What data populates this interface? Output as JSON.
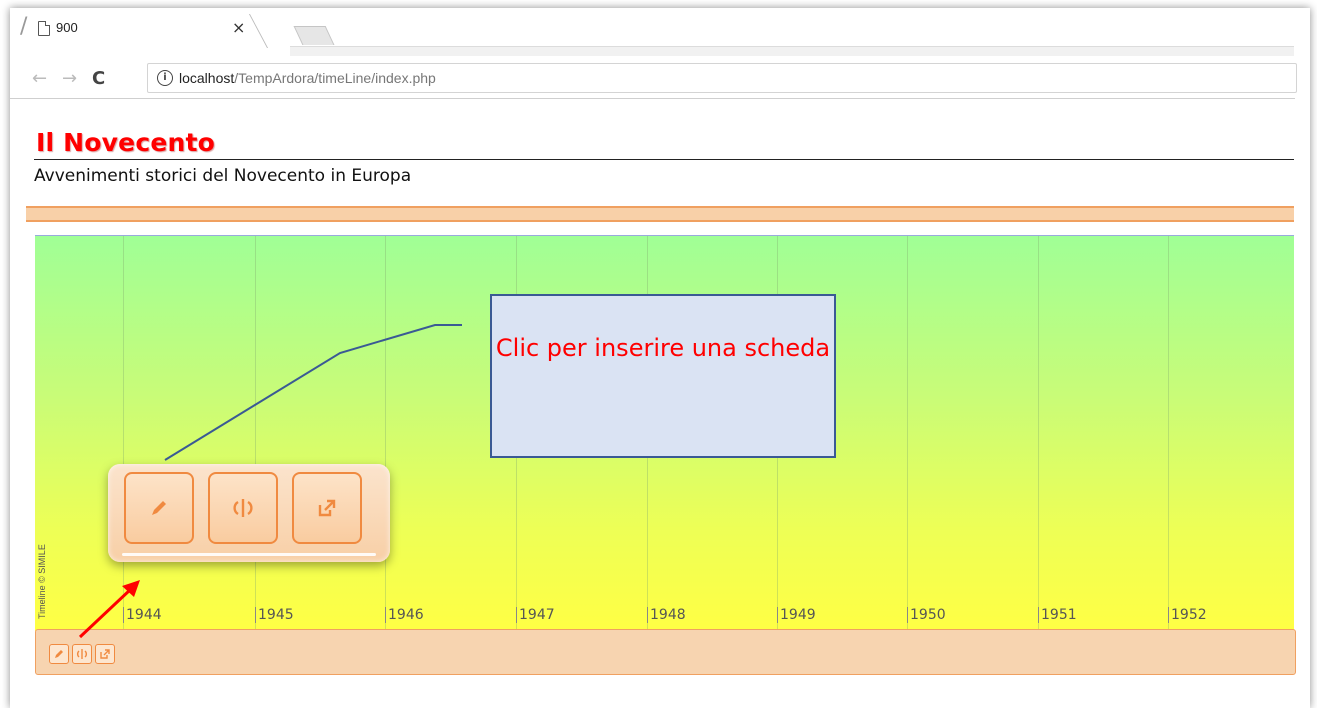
{
  "browser": {
    "tab_title": "900",
    "tab_close": "×",
    "url_host": "localhost",
    "url_path": "/TempArdora/timeLine/index.php",
    "info_icon": "i"
  },
  "page": {
    "title": "Il Novecento",
    "subtitle": "Avvenimenti storici del Novecento in Europa"
  },
  "timeline": {
    "credit": "Timeline © SIMILE",
    "years": [
      "1944",
      "1945",
      "1946",
      "1947",
      "1948",
      "1949",
      "1950",
      "1951",
      "1952"
    ],
    "gradient_colors": [
      "#a0ff96",
      "#ffff44"
    ]
  },
  "popup": {
    "buttons": [
      {
        "name": "edit",
        "icon": "pencil-icon"
      },
      {
        "name": "refresh",
        "icon": "refresh-icon"
      },
      {
        "name": "open",
        "icon": "external-link-icon"
      }
    ]
  },
  "callout": {
    "text": "Clic per inserire una scheda"
  },
  "colors": {
    "title": "#ff0000",
    "accent_orange": "#f08a40",
    "callout_fill": "#dae3f3",
    "callout_border": "#3a5a94",
    "arrow": "#ff0000"
  }
}
